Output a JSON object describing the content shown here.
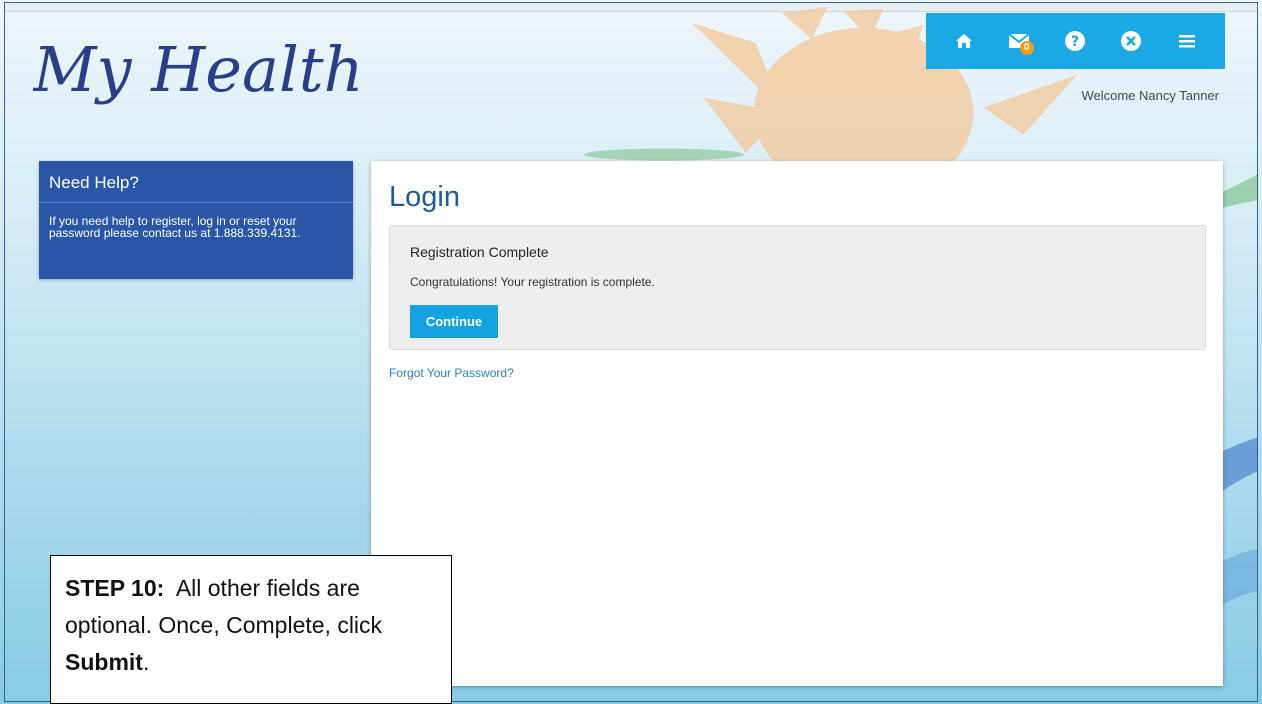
{
  "app": {
    "logo_text": "My Health"
  },
  "topbar": {
    "icons": [
      "home-icon",
      "mail-icon",
      "help-icon",
      "close-icon",
      "menu-icon"
    ],
    "mail_badge": "0",
    "accent": "#1aa9e4"
  },
  "header": {
    "welcome": "Welcome Nancy Tanner"
  },
  "help_box": {
    "title": "Need Help?",
    "body": "If you need help to register, log in or reset your password please contact us at 1.888.339.4131."
  },
  "main": {
    "title": "Login",
    "panel_title": "Registration Complete",
    "panel_text": "Congratulations! Your registration is complete.",
    "continue_label": "Continue",
    "forgot_link": "Forgot Your Password?"
  },
  "callout": {
    "step_label": "STEP 10:",
    "text1": "All other fields are optional.  Once, Complete, click",
    "bold_word": "Submit",
    "text2": "."
  },
  "colors": {
    "help_box": "#2a56a8",
    "title": "#1e5c91",
    "button": "#12a3e0",
    "link": "#2a7fc0"
  }
}
